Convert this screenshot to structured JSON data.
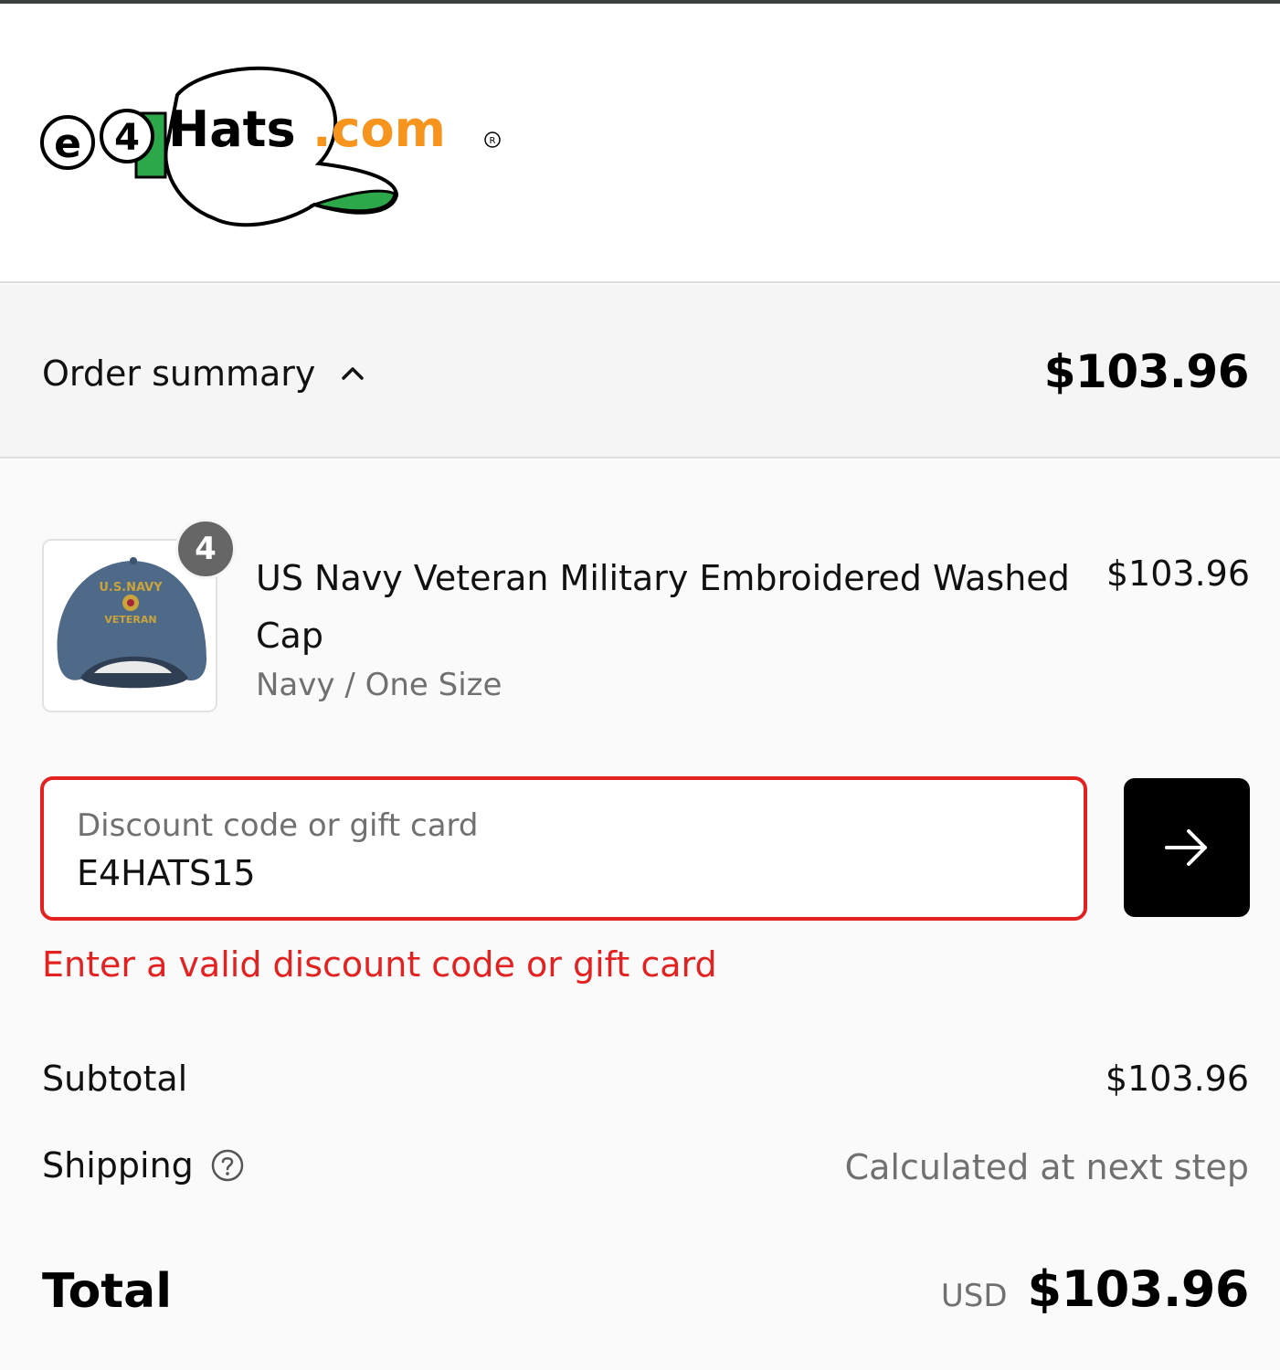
{
  "logo": {
    "text": "e4Hats.com",
    "brand_colors": {
      "orange": "#f7941d",
      "green": "#2ca84a",
      "black": "#000000"
    }
  },
  "summary": {
    "toggle_label": "Order summary",
    "toggle_icon": "chevron-up-icon",
    "total": "$103.96"
  },
  "product": {
    "quantity": "4",
    "name": "US Navy Veteran Military Embroidered Washed Cap",
    "variant": "Navy / One Size",
    "price": "$103.96",
    "image_icon": "navy-cap-image"
  },
  "discount": {
    "label": "Discount code or gift card",
    "value": "E4HATS15",
    "apply_icon": "arrow-right-icon",
    "error": "Enter a valid discount code or gift card"
  },
  "totals": {
    "subtotal_label": "Subtotal",
    "subtotal_value": "$103.96",
    "shipping_label": "Shipping",
    "shipping_help_icon": "question-circle-icon",
    "shipping_value": "Calculated at next step",
    "total_label": "Total",
    "currency": "USD",
    "total_value": "$103.96"
  },
  "colors": {
    "error": "#e22120",
    "muted": "#707070",
    "button": "#000000"
  }
}
